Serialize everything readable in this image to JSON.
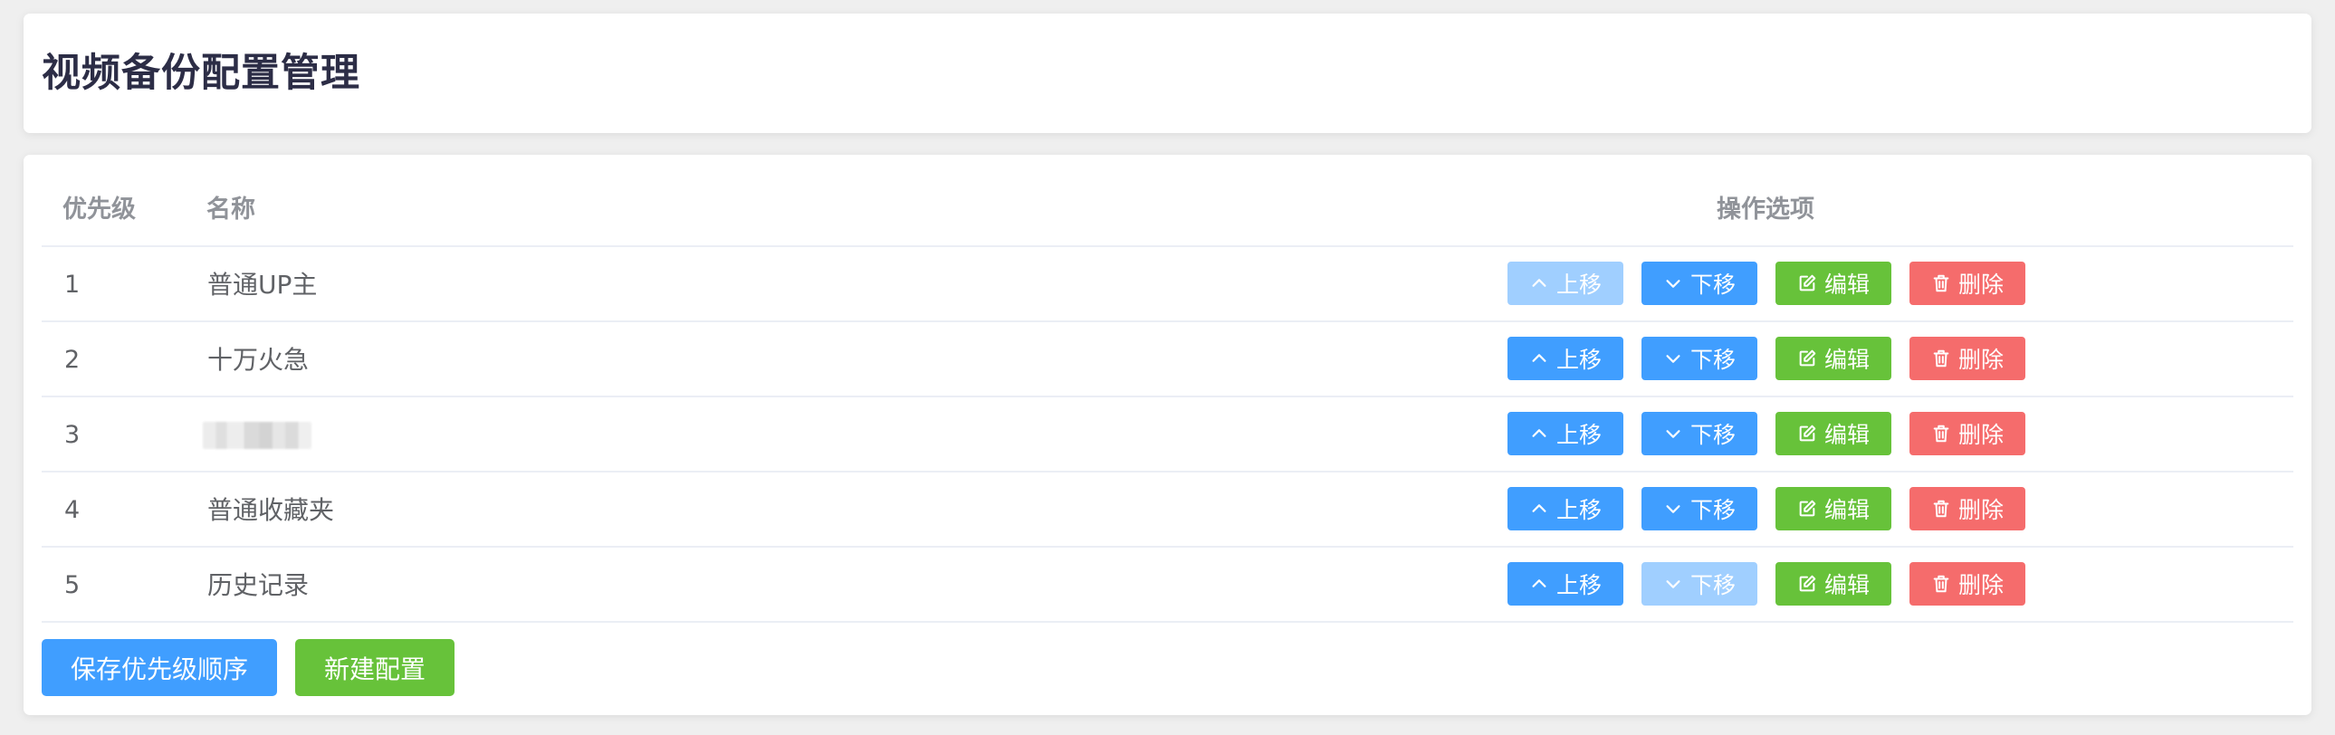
{
  "header": {
    "title": "视频备份配置管理"
  },
  "table": {
    "columns": {
      "priority": "优先级",
      "name": "名称",
      "actions": "操作选项"
    },
    "rows": [
      {
        "priority": "1",
        "name": "普通UP主",
        "blurred": false,
        "up_disabled": true,
        "down_disabled": false
      },
      {
        "priority": "2",
        "name": "十万火急",
        "blurred": false,
        "up_disabled": false,
        "down_disabled": false
      },
      {
        "priority": "3",
        "name": "",
        "blurred": true,
        "up_disabled": false,
        "down_disabled": false
      },
      {
        "priority": "4",
        "name": "普通收藏夹",
        "blurred": false,
        "up_disabled": false,
        "down_disabled": false
      },
      {
        "priority": "5",
        "name": "历史记录",
        "blurred": false,
        "up_disabled": false,
        "down_disabled": true
      }
    ],
    "row_actions": {
      "up": "上移",
      "down": "下移",
      "edit": "编辑",
      "delete": "删除"
    }
  },
  "footer": {
    "save_label": "保存优先级顺序",
    "new_label": "新建配置"
  },
  "colors": {
    "primary": "#409eff",
    "primary_disabled": "#a0cfff",
    "success": "#67c23a",
    "danger": "#f56c6c"
  },
  "icons": {
    "up": "chevron-up-icon",
    "down": "chevron-down-icon",
    "edit": "edit-icon",
    "delete": "trash-icon"
  }
}
